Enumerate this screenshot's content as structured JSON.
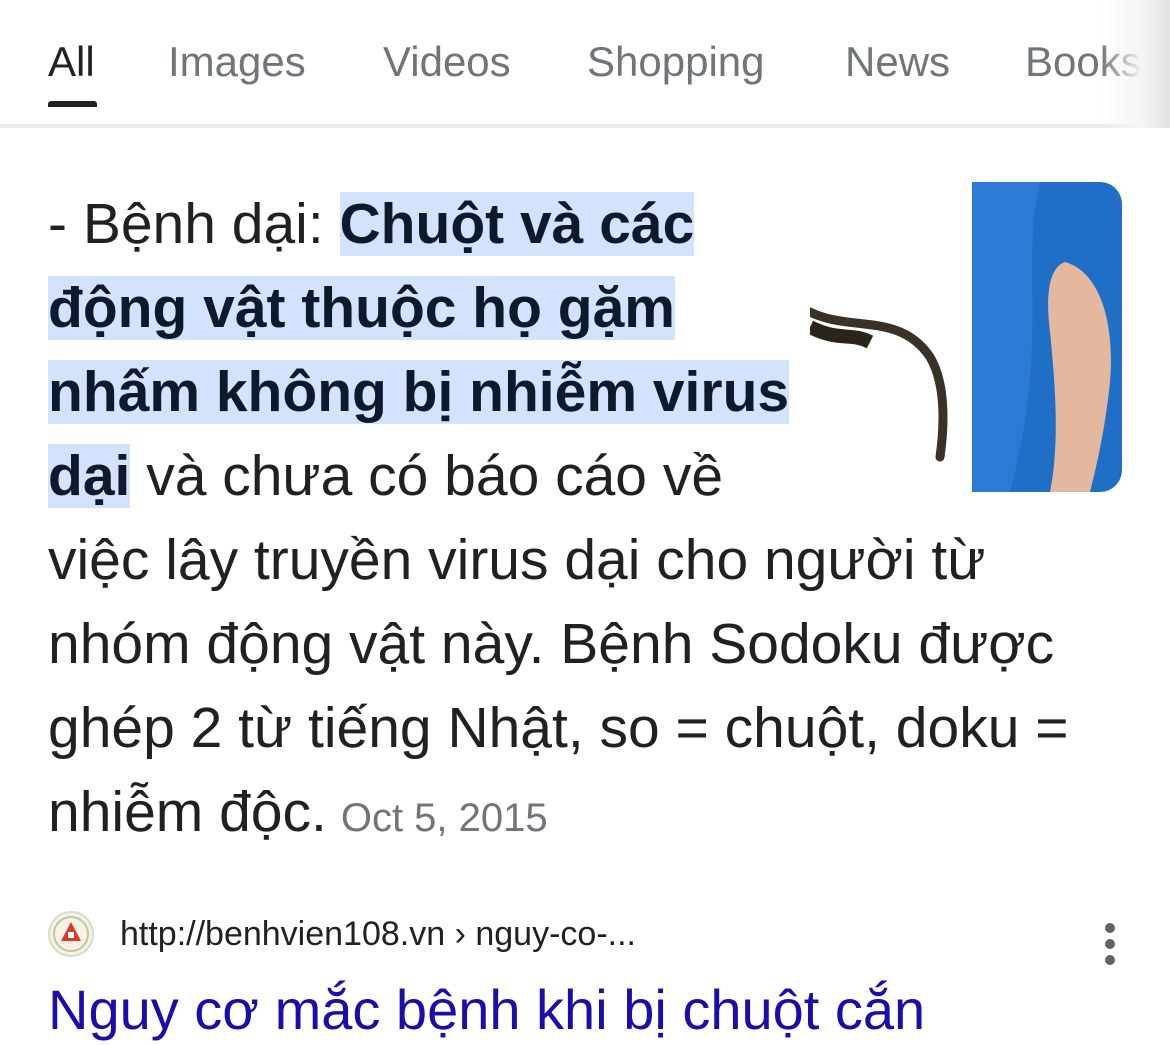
{
  "tabs": [
    {
      "label": "All",
      "active": true
    },
    {
      "label": "Images",
      "active": false
    },
    {
      "label": "Videos",
      "active": false
    },
    {
      "label": "Shopping",
      "active": false
    },
    {
      "label": "News",
      "active": false
    },
    {
      "label": "Books",
      "active": false
    }
  ],
  "snippet": {
    "prefix": "- Bệnh dại: ",
    "highlight": "Chuột và các động vật thuộc họ gặm nhấm không bị nhiễm virus dại",
    "body": " và chưa có báo cáo về việc lây truyền virus dại cho người từ nhóm động vật này. Bệnh Sodoku được ghép 2 từ tiếng Nhật, so = chuột, doku = nhiễm độc.",
    "date": "Oct 5, 2015"
  },
  "result": {
    "url": "http://benhvien108.vn › nguy-co-...",
    "title": "Nguy cơ mắc bệnh khi bị chuột cắn"
  },
  "colors": {
    "highlight": "#d3e3fd",
    "link": "#1a0dab",
    "muted": "#70757a"
  },
  "icons": {
    "favicon": "hospital-logo-icon",
    "more": "more-vert-icon"
  }
}
